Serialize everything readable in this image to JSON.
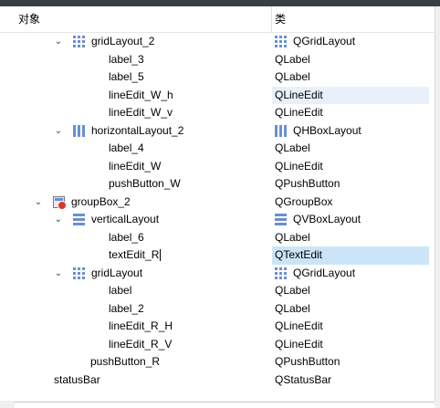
{
  "header": {
    "col_object": "对象",
    "col_class": "类"
  },
  "rows": [
    {
      "name": "gridLayout_2",
      "type": "QGridLayout",
      "indent": 2,
      "expander": true,
      "icon": "grid",
      "type_icon": "grid"
    },
    {
      "name": "label_3",
      "type": "QLabel",
      "indent": 3
    },
    {
      "name": "label_5",
      "type": "QLabel",
      "indent": 3
    },
    {
      "name": "lineEdit_W_h",
      "type": "QLineEdit",
      "indent": 3,
      "highlight": true
    },
    {
      "name": "lineEdit_W_v",
      "type": "QLineEdit",
      "indent": 3
    },
    {
      "name": "horizontalLayout_2",
      "type": "QHBoxLayout",
      "indent": 2,
      "expander": true,
      "icon": "hbox",
      "type_icon": "hbox"
    },
    {
      "name": "label_4",
      "type": "QLabel",
      "indent": 3
    },
    {
      "name": "lineEdit_W",
      "type": "QLineEdit",
      "indent": 3
    },
    {
      "name": "pushButton_W",
      "type": "QPushButton",
      "indent": 3
    },
    {
      "name": "groupBox_2",
      "type": "QGroupBox",
      "indent": 1,
      "expander": true,
      "icon": "group"
    },
    {
      "name": "verticalLayout",
      "type": "QVBoxLayout",
      "indent": 2,
      "expander": true,
      "icon": "vbox",
      "type_icon": "vbox"
    },
    {
      "name": "label_6",
      "type": "QLabel",
      "indent": 3
    },
    {
      "name": "textEdit_R",
      "type": "QTextEdit",
      "indent": 3,
      "selected": true,
      "caret": true
    },
    {
      "name": "gridLayout",
      "type": "QGridLayout",
      "indent": 2,
      "expander": true,
      "icon": "grid",
      "type_icon": "grid"
    },
    {
      "name": "label",
      "type": "QLabel",
      "indent": 3
    },
    {
      "name": "label_2",
      "type": "QLabel",
      "indent": 3
    },
    {
      "name": "lineEdit_R_H",
      "type": "QLineEdit",
      "indent": 3
    },
    {
      "name": "lineEdit_R_V",
      "type": "QLineEdit",
      "indent": 3
    },
    {
      "name": "pushButton_R",
      "type": "QPushButton",
      "indent": 2
    },
    {
      "name": "statusBar",
      "type": "QStatusBar",
      "indent": 1
    }
  ],
  "colors": {
    "selected": "#cce4f7",
    "hover": "#e8f1fb",
    "icon": "#6a8fd0",
    "badge": "#d23a2b"
  }
}
